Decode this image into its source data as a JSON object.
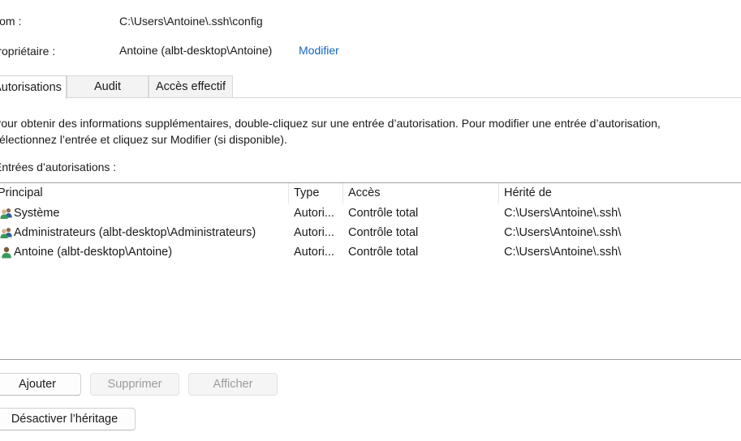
{
  "header": {
    "name_label": "Nom :",
    "name_value": "C:\\Users\\Antoine\\.ssh\\config",
    "owner_label": "Propriétaire :",
    "owner_value": "Antoine (albt-desktop\\Antoine)",
    "owner_change_link": "Modifier"
  },
  "tabs": [
    {
      "label": "Autorisations",
      "active": true
    },
    {
      "label": "Audit",
      "active": false
    },
    {
      "label": "Accès effectif",
      "active": false
    }
  ],
  "info": {
    "line1": "Pour obtenir des informations supplémentaires, double-cliquez sur une entrée d’autorisation. Pour modifier une entrée d’autorisation,",
    "line2": "sélectionnez l’entrée et cliquez sur Modifier (si disponible).",
    "entries_label": "Entrées d’autorisations :"
  },
  "table": {
    "columns": [
      "Principal",
      "Type",
      "Accès",
      "Hérité de"
    ],
    "rows": [
      {
        "principal": "Système",
        "type": "Autori...",
        "access": "Contrôle total",
        "inherited": "C:\\Users\\Antoine\\.ssh\\",
        "icon": "group-users-icon"
      },
      {
        "principal": "Administrateurs (albt-desktop\\Administrateurs)",
        "type": "Autori...",
        "access": "Contrôle total",
        "inherited": "C:\\Users\\Antoine\\.ssh\\",
        "icon": "group-users-icon"
      },
      {
        "principal": "Antoine (albt-desktop\\Antoine)",
        "type": "Autori...",
        "access": "Contrôle total",
        "inherited": "C:\\Users\\Antoine\\.ssh\\",
        "icon": "user-icon"
      }
    ]
  },
  "buttons": {
    "add": "Ajouter",
    "remove": "Supprimer",
    "view": "Afficher",
    "disable_inheritance": "Désactiver l’héritage"
  },
  "colors": {
    "link": "#1565c0",
    "disabled_text": "#9b9b9b"
  }
}
